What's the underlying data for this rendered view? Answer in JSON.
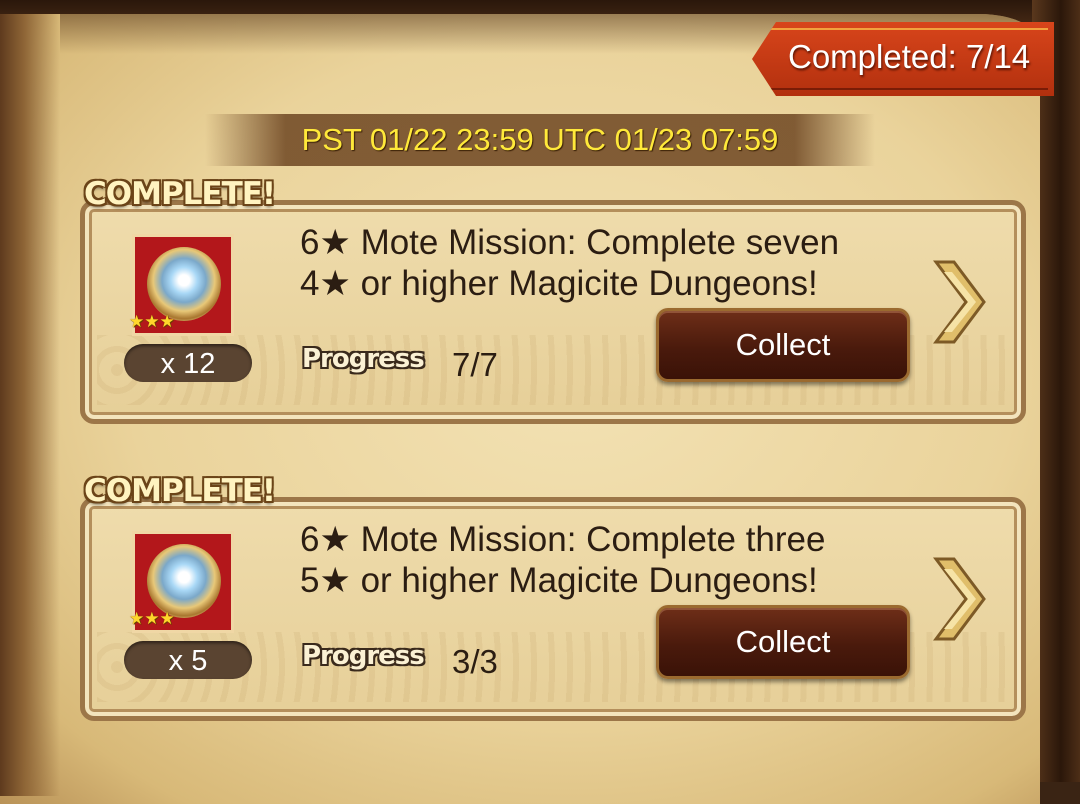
{
  "header": {
    "completed_label": "Completed: 7/14",
    "deadline": "PST 01/22 23:59 UTC 01/23 07:59"
  },
  "missions": [
    {
      "status": "COMPLETE!",
      "reward_icon": "crystal-mote-icon",
      "reward_stars": "★★★",
      "reward_quantity": "x 12",
      "title_line1": "6★ Mote Mission: Complete seven",
      "title_line2": "4★ or higher Magicite Dungeons!",
      "progress_label": "Progress",
      "progress_value": "7/7",
      "button_label": "Collect"
    },
    {
      "status": "COMPLETE!",
      "reward_icon": "crystal-mote-icon",
      "reward_stars": "★★★",
      "reward_quantity": "x 5",
      "title_line1": "6★ Mote Mission: Complete three",
      "title_line2": "5★ or higher Magicite Dungeons!",
      "progress_label": "Progress",
      "progress_value": "3/3",
      "button_label": "Collect"
    }
  ],
  "colors": {
    "banner": "#c93a15",
    "deadline_text": "#ffe93a",
    "button": "#4a1a0c",
    "parchment": "#ead39b"
  }
}
